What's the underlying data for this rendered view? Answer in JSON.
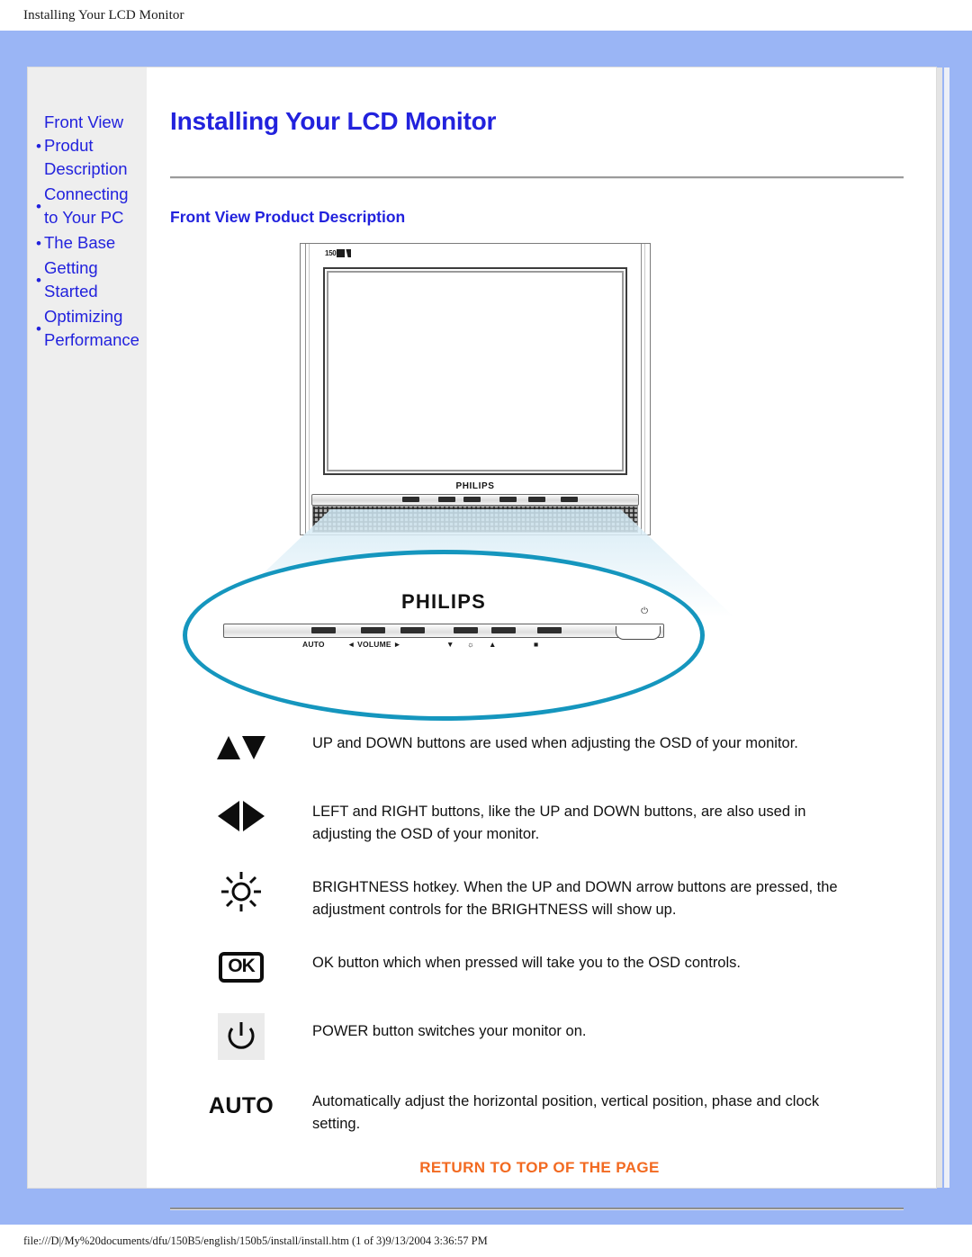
{
  "window": {
    "header_title": "Installing Your LCD Monitor",
    "footer_path": "file:///D|/My%20documents/dfu/150B5/english/150b5/install/install.htm (1 of 3)9/13/2004 3:36:57 PM"
  },
  "colors": {
    "link_blue": "#2222dd",
    "frame_blue": "#9ab5f5",
    "sidebar_gray": "#eeeeee",
    "callout_cyan": "#1596be",
    "return_orange": "#f26a21"
  },
  "sidebar": {
    "items": [
      {
        "label": "Front View Produt Description",
        "bullet": "•"
      },
      {
        "label": "Connecting to Your PC",
        "bullet": "•"
      },
      {
        "label": "The Base",
        "bullet": "•"
      },
      {
        "label": "Getting Started",
        "bullet": "•"
      },
      {
        "label": "Optimizing Performance",
        "bullet": "•"
      }
    ]
  },
  "main": {
    "title": "Installing Your LCD Monitor",
    "section_title": "Front View Product Description",
    "return_link": "RETURN TO TOP OF THE PAGE"
  },
  "figure": {
    "screen_badge": "150",
    "brand": "PHILIPS",
    "callout_brand": "PHILIPS",
    "control_labels": [
      "AUTO",
      "◄ VOLUME ►",
      "▼",
      "☼",
      "▲",
      "■"
    ],
    "power_glyph": "⏻"
  },
  "descriptions": [
    {
      "icon_name": "up-down-arrows-icon",
      "icon_type": "updown",
      "icon_text": "",
      "text": "UP and DOWN buttons are used when adjusting the OSD of your monitor."
    },
    {
      "icon_name": "left-right-arrows-icon",
      "icon_type": "leftright",
      "icon_text": "",
      "text": "LEFT and RIGHT buttons, like the UP and DOWN buttons, are also used in adjusting the OSD of your monitor."
    },
    {
      "icon_name": "brightness-icon",
      "icon_type": "brightness",
      "icon_text": "",
      "text": "BRIGHTNESS hotkey. When the UP and DOWN arrow buttons are pressed, the adjustment controls for the BRIGHTNESS will show up."
    },
    {
      "icon_name": "ok-button-icon",
      "icon_type": "ok",
      "icon_text": "OK",
      "text": "OK button which when pressed will take you to the OSD controls."
    },
    {
      "icon_name": "power-button-icon",
      "icon_type": "power",
      "icon_text": "",
      "text": "POWER button switches your monitor on."
    },
    {
      "icon_name": "auto-button-icon",
      "icon_type": "auto",
      "icon_text": "AUTO",
      "text": "Automatically adjust the horizontal position, vertical position, phase and clock setting."
    }
  ]
}
